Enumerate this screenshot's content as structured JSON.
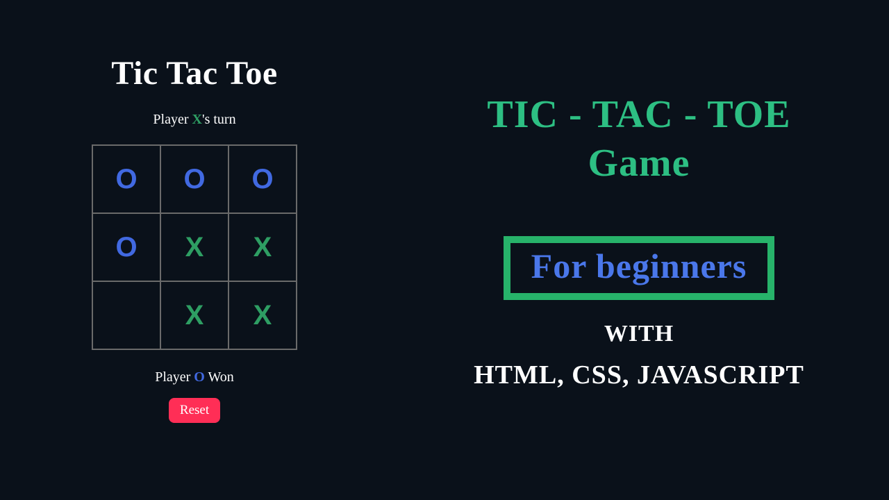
{
  "game": {
    "title": "Tic Tac Toe",
    "turn_prefix": "Player ",
    "turn_player": "X",
    "turn_suffix": "'s turn",
    "board": [
      "O",
      "O",
      "O",
      "O",
      "X",
      "X",
      "",
      "X",
      "X"
    ],
    "result_prefix": "Player ",
    "result_player": "O",
    "result_suffix": " Won",
    "reset_label": "Reset"
  },
  "promo": {
    "title_line1": "TIC - TAC - TOE",
    "title_line2": "Game",
    "badge": "For beginners",
    "with": "WITH",
    "tech": "HTML, CSS, JAVASCRIPT"
  },
  "colors": {
    "x": "#2e9e63",
    "o": "#4169e1",
    "accent": "#27b36a",
    "reset": "#ff2e56",
    "bg": "#0a111a"
  }
}
